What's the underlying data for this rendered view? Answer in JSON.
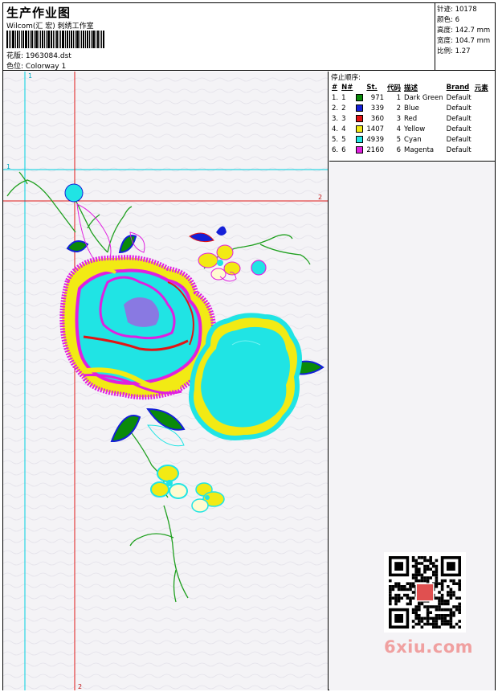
{
  "header": {
    "title": "生产作业图",
    "company": "Wilcom(汇 宏) 刺绣工作室",
    "design_label": "花版:",
    "design_value": "1963084.dst",
    "colorway_label": "色位:",
    "colorway_value": "Colorway 1"
  },
  "stats": [
    {
      "label": "针迹:",
      "value": "10178"
    },
    {
      "label": "颜色:",
      "value": "6"
    },
    {
      "label": "高度:",
      "value": "142.7 mm"
    },
    {
      "label": "宽度:",
      "value": "104.7 mm"
    },
    {
      "label": "比例:",
      "value": "1.27"
    }
  ],
  "stop_sequence": {
    "title": "停止顺序:",
    "columns": [
      "#",
      "N#",
      "St.",
      "代码",
      "描述",
      "Brand",
      "元素"
    ],
    "rows": [
      {
        "num": "1.",
        "n": "1",
        "color": "#0a8a0a",
        "stitches": "971",
        "code": "1",
        "desc": "Dark Green",
        "brand": "Default"
      },
      {
        "num": "2.",
        "n": "2",
        "color": "#1420d8",
        "stitches": "339",
        "code": "2",
        "desc": "Blue",
        "brand": "Default"
      },
      {
        "num": "3.",
        "n": "3",
        "color": "#e21414",
        "stitches": "360",
        "code": "3",
        "desc": "Red",
        "brand": "Default"
      },
      {
        "num": "4.",
        "n": "4",
        "color": "#f2ea14",
        "stitches": "1407",
        "code": "4",
        "desc": "Yellow",
        "brand": "Default"
      },
      {
        "num": "5.",
        "n": "5",
        "color": "#20e4e4",
        "stitches": "4939",
        "code": "5",
        "desc": "Cyan",
        "brand": "Default"
      },
      {
        "num": "6.",
        "n": "6",
        "color": "#e020e0",
        "stitches": "2160",
        "code": "6",
        "desc": "Magenta",
        "brand": "Default"
      }
    ]
  },
  "guides": {
    "cyan_label": "1",
    "red_label": "2"
  },
  "watermark": "6xiu.com"
}
